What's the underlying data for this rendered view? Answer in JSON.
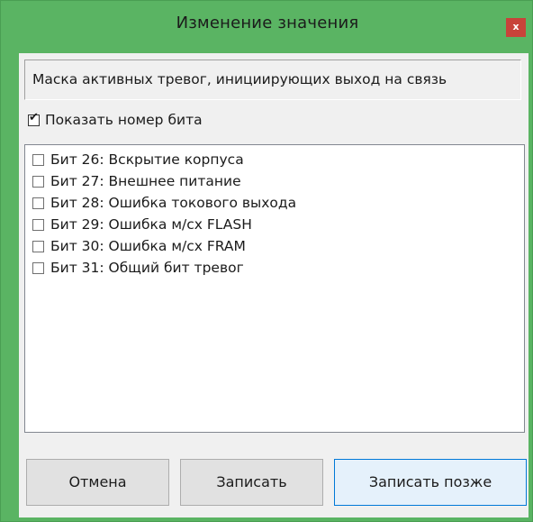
{
  "window": {
    "title": "Изменение значения",
    "close_glyph": "x",
    "accent_color": "#5ab463",
    "close_color": "#c8433a"
  },
  "description": "Маска активных тревог, инициирующих выход на связь",
  "show_bits": {
    "label": "Показать номер бита",
    "checked": true
  },
  "bits": [
    {
      "label": "Бит 26: Вскрытие корпуса",
      "checked": false
    },
    {
      "label": "Бит 27: Внешнее питание",
      "checked": false
    },
    {
      "label": "Бит 28: Ошибка токового выхода",
      "checked": false
    },
    {
      "label": "Бит 29: Ошибка м/сх FLASH",
      "checked": false
    },
    {
      "label": "Бит 30: Ошибка м/сх FRAM",
      "checked": false
    },
    {
      "label": "Бит 31: Общий бит тревог",
      "checked": false
    }
  ],
  "buttons": {
    "cancel": "Отмена",
    "write": "Записать",
    "write_later": "Записать позже"
  }
}
